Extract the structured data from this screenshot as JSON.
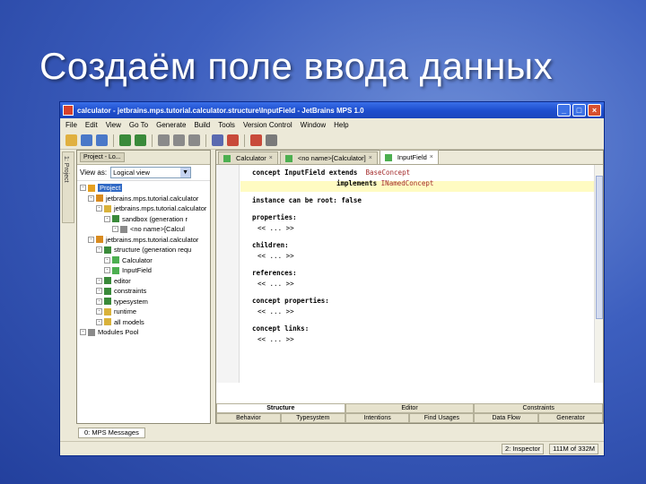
{
  "slide": {
    "title": "Создаём поле ввода данных"
  },
  "window": {
    "title": "calculator - jetbrains.mps.tutorial.calculator.structure\\InputField - JetBrains MPS 1.0",
    "controls": {
      "minimize": "_",
      "maximize": "□",
      "close": "×"
    }
  },
  "menu": [
    "File",
    "Edit",
    "View",
    "Go To",
    "Generate",
    "Build",
    "Tools",
    "Version Control",
    "Window",
    "Help"
  ],
  "toolbar": {
    "icons": [
      "folder-icon",
      "save-icon",
      "save-all-icon",
      "undo-icon",
      "redo-icon",
      "cut-icon",
      "copy-icon",
      "paste-icon",
      "find-icon",
      "make-icon",
      "rebuild-icon",
      "settings-icon"
    ]
  },
  "sidestrip": {
    "label": "1: Project"
  },
  "project_panel": {
    "tab_label": "Project - Lo...",
    "view_as_label": "View as:",
    "view_as_value": "Logical view",
    "tree": [
      {
        "label": "Project",
        "depth": 0,
        "selected": true,
        "icon": "project-icon",
        "color": "#e6a020"
      },
      {
        "label": "jetbrains.mps.tutorial.calculator",
        "depth": 1,
        "icon": "solution-icon",
        "color": "#d98b1f"
      },
      {
        "label": "jetbrains.mps.tutorial.calculator",
        "depth": 2,
        "icon": "package-icon",
        "color": "#d9b23a"
      },
      {
        "label": "sandbox (generation r",
        "depth": 3,
        "icon": "model-icon",
        "color": "#3a8a3a"
      },
      {
        "label": "<no name>[Calcul",
        "depth": 4,
        "icon": "root-icon",
        "color": "#8a8a8a"
      },
      {
        "label": "jetbrains.mps.tutorial.calculator",
        "depth": 1,
        "icon": "language-icon",
        "color": "#d98b1f"
      },
      {
        "label": "structure (generation requ",
        "depth": 2,
        "icon": "model-icon",
        "color": "#3a8a3a"
      },
      {
        "label": "Calculator",
        "depth": 3,
        "icon": "concept-icon",
        "color": "#4caf50"
      },
      {
        "label": "InputField",
        "depth": 3,
        "icon": "concept-icon",
        "color": "#4caf50"
      },
      {
        "label": "editor",
        "depth": 2,
        "icon": "model-icon",
        "color": "#3a8a3a"
      },
      {
        "label": "constraints",
        "depth": 2,
        "icon": "model-icon",
        "color": "#3a8a3a"
      },
      {
        "label": "typesystem",
        "depth": 2,
        "icon": "model-icon",
        "color": "#3a8a3a"
      },
      {
        "label": "runtime",
        "depth": 2,
        "icon": "folder-icon",
        "color": "#d9b23a"
      },
      {
        "label": "all models",
        "depth": 2,
        "icon": "folder-icon",
        "color": "#d9b23a"
      },
      {
        "label": "Modules Pool",
        "depth": 0,
        "icon": "pool-icon",
        "color": "#8a8a8a"
      }
    ]
  },
  "editor": {
    "tabs": [
      {
        "label": "Calculator",
        "active": false
      },
      {
        "label": "<no name>[Calculator]",
        "active": false
      },
      {
        "label": "InputField",
        "active": true
      }
    ],
    "code": [
      {
        "kind": "decl",
        "a": "concept InputField extends",
        "b": "BaseConcept"
      },
      {
        "kind": "impl",
        "a": "implements",
        "b": "INamedConcept"
      },
      {
        "kind": "blank"
      },
      {
        "kind": "text",
        "a": "instance can be root: false"
      },
      {
        "kind": "blank"
      },
      {
        "kind": "text",
        "a": "properties:"
      },
      {
        "kind": "text",
        "a": "<< ... >>"
      },
      {
        "kind": "blank"
      },
      {
        "kind": "text",
        "a": "children:"
      },
      {
        "kind": "text",
        "a": "<< ... >>"
      },
      {
        "kind": "blank"
      },
      {
        "kind": "text",
        "a": "references:"
      },
      {
        "kind": "text",
        "a": "<< ... >>"
      },
      {
        "kind": "blank"
      },
      {
        "kind": "text",
        "a": "concept properties:"
      },
      {
        "kind": "text",
        "a": "<< ... >>"
      },
      {
        "kind": "blank"
      },
      {
        "kind": "text",
        "a": "concept links:"
      },
      {
        "kind": "text",
        "a": "<< ... >>"
      }
    ],
    "aspect_row1": [
      {
        "label": "Structure",
        "active": true
      },
      {
        "label": "Editor",
        "active": false
      },
      {
        "label": "Constraints",
        "active": false
      }
    ],
    "aspect_row2": [
      {
        "label": "Behavior"
      },
      {
        "label": "Typesystem"
      },
      {
        "label": "Intentions"
      },
      {
        "label": "Find Usages"
      },
      {
        "label": "Data Flow"
      },
      {
        "label": "Generator"
      }
    ]
  },
  "bottom": {
    "messages_tab": "0: MPS Messages"
  },
  "status": {
    "inspector": "2: Inspector",
    "memory": "111M of 332M"
  }
}
